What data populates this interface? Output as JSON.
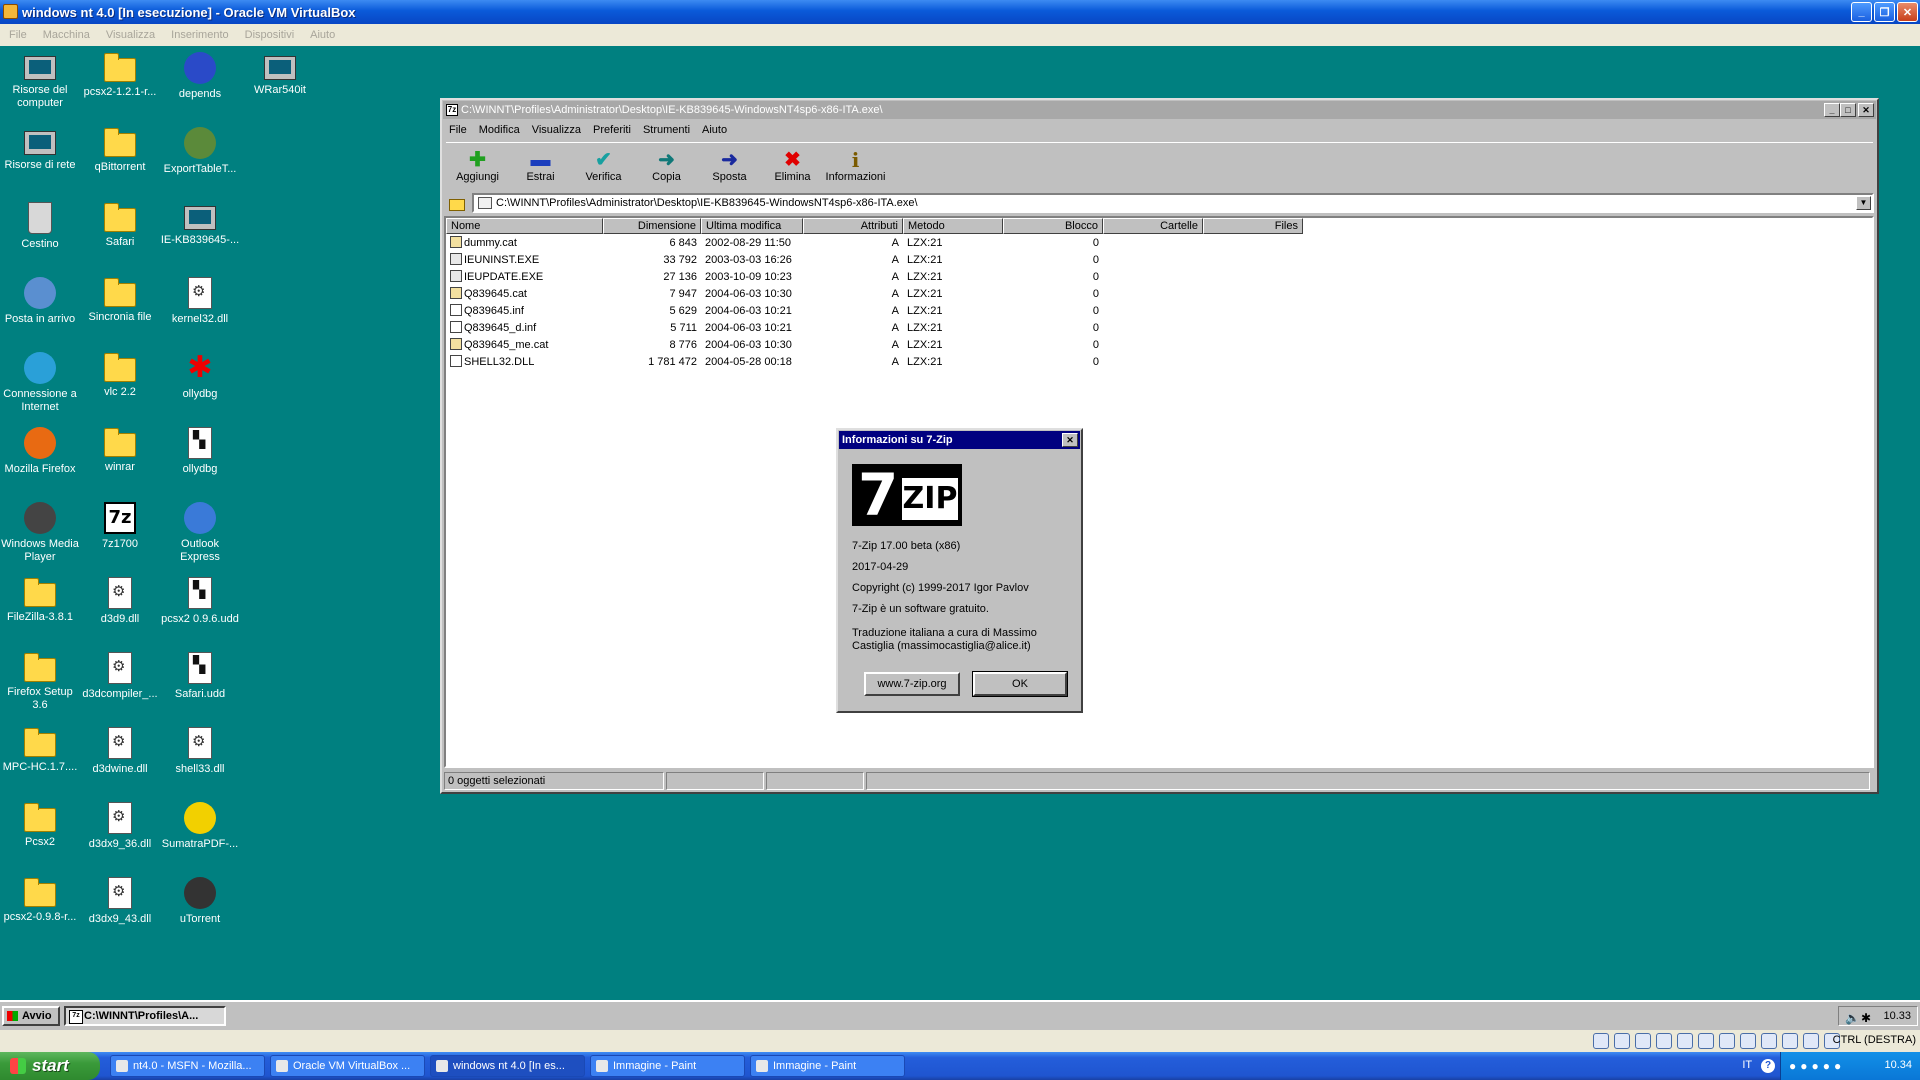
{
  "host": {
    "title": "windows nt 4.0 [In esecuzione] - Oracle VM VirtualBox",
    "menu": [
      "File",
      "Macchina",
      "Visualizza",
      "Inserimento",
      "Dispositivi",
      "Aiuto"
    ],
    "min_glyph": "_",
    "max_glyph": "❐",
    "close_glyph": "✕"
  },
  "desktop": {
    "icons": [
      {
        "label": "Risorse del computer",
        "icon": "computer-icon"
      },
      {
        "label": "pcsx2-1.2.1-r...",
        "icon": "folder-icon"
      },
      {
        "label": "depends",
        "icon": "depends-icon"
      },
      {
        "label": "WRar540it",
        "icon": "winrar-installer-icon"
      },
      {
        "label": "Risorse di rete",
        "icon": "network-icon"
      },
      {
        "label": "qBittorrent",
        "icon": "folder-icon"
      },
      {
        "label": "ExportTableT...",
        "icon": "app-icon"
      },
      {
        "label": "Cestino",
        "icon": "recycle-bin-icon"
      },
      {
        "label": "Safari",
        "icon": "folder-icon"
      },
      {
        "label": "IE-KB839645-...",
        "icon": "installer-icon"
      },
      {
        "label": "Posta in arrivo",
        "icon": "inbox-icon"
      },
      {
        "label": "Sincronia file",
        "icon": "briefcase-icon"
      },
      {
        "label": "kernel32.dll",
        "icon": "dll-file-icon"
      },
      {
        "label": "Connessione a Internet",
        "icon": "internet-connection-icon"
      },
      {
        "label": "vlc 2.2",
        "icon": "folder-icon"
      },
      {
        "label": "ollydbg",
        "icon": "ollydbg-icon"
      },
      {
        "label": "Mozilla Firefox",
        "icon": "firefox-icon"
      },
      {
        "label": "winrar",
        "icon": "folder-icon"
      },
      {
        "label": "ollydbg",
        "icon": "text-file-icon"
      },
      {
        "label": "Windows Media Player",
        "icon": "media-player-icon"
      },
      {
        "label": "7z1700",
        "icon": "7zip-icon"
      },
      {
        "label": "Outlook Express",
        "icon": "outlook-express-icon"
      },
      {
        "label": "FileZilla-3.8.1",
        "icon": "folder-icon"
      },
      {
        "label": "d3d9.dll",
        "icon": "dll-file-icon"
      },
      {
        "label": "pcsx2 0.9.6.udd",
        "icon": "udd-file-icon"
      },
      {
        "label": "Firefox Setup 3.6",
        "icon": "folder-icon"
      },
      {
        "label": "d3dcompiler_...",
        "icon": "dll-file-icon"
      },
      {
        "label": "Safari.udd",
        "icon": "udd-file-icon"
      },
      {
        "label": "MPC-HC.1.7....",
        "icon": "folder-icon"
      },
      {
        "label": "d3dwine.dll",
        "icon": "dll-file-icon"
      },
      {
        "label": "shell33.dll",
        "icon": "dll-file-icon"
      },
      {
        "label": "Pcsx2",
        "icon": "folder-icon"
      },
      {
        "label": "d3dx9_36.dll",
        "icon": "dll-file-icon"
      },
      {
        "label": "SumatraPDF-...",
        "icon": "pdf-icon"
      },
      {
        "label": "pcsx2-0.9.8-r...",
        "icon": "folder-icon"
      },
      {
        "label": "d3dx9_43.dll",
        "icon": "dll-file-icon"
      },
      {
        "label": "uTorrent",
        "icon": "utorrent-icon"
      }
    ]
  },
  "zip": {
    "title": "C:\\WINNT\\Profiles\\Administrator\\Desktop\\IE-KB839645-WindowsNT4sp6-x86-ITA.exe\\",
    "app_icon_text": "7z",
    "menu": [
      "File",
      "Modifica",
      "Visualizza",
      "Preferiti",
      "Strumenti",
      "Aiuto"
    ],
    "toolbar": [
      {
        "label": "Aggiungi",
        "glyph": "✚",
        "cls": "add",
        "icon": "add-icon"
      },
      {
        "label": "Estrai",
        "glyph": "▬",
        "cls": "ext",
        "icon": "extract-icon"
      },
      {
        "label": "Verifica",
        "glyph": "✔",
        "cls": "ver",
        "icon": "test-icon"
      },
      {
        "label": "Copia",
        "glyph": "➜",
        "cls": "cpy",
        "icon": "copy-icon"
      },
      {
        "label": "Sposta",
        "glyph": "➜",
        "cls": "mov",
        "icon": "move-icon"
      },
      {
        "label": "Elimina",
        "glyph": "✖",
        "cls": "del",
        "icon": "delete-icon"
      },
      {
        "label": "Informazioni",
        "glyph": "i",
        "cls": "inf",
        "icon": "info-icon"
      }
    ],
    "address": "C:\\WINNT\\Profiles\\Administrator\\Desktop\\IE-KB839645-WindowsNT4sp6-x86-ITA.exe\\",
    "dropdown_glyph": "▼",
    "columns": [
      "Nome",
      "Dimensione",
      "Ultima modifica",
      "Attributi",
      "Metodo",
      "Blocco",
      "Cartelle",
      "Files"
    ],
    "files": [
      {
        "name": "dummy.cat",
        "size": "6 843",
        "modified": "2002-08-29 11:50",
        "attr": "A",
        "method": "LZX:21",
        "block": "0",
        "type": "cat"
      },
      {
        "name": "IEUNINST.EXE",
        "size": "33 792",
        "modified": "2003-03-03 16:26",
        "attr": "A",
        "method": "LZX:21",
        "block": "0",
        "type": "exe"
      },
      {
        "name": "IEUPDATE.EXE",
        "size": "27 136",
        "modified": "2003-10-09 10:23",
        "attr": "A",
        "method": "LZX:21",
        "block": "0",
        "type": "exe"
      },
      {
        "name": "Q839645.cat",
        "size": "7 947",
        "modified": "2004-06-03 10:30",
        "attr": "A",
        "method": "LZX:21",
        "block": "0",
        "type": "cat"
      },
      {
        "name": "Q839645.inf",
        "size": "5 629",
        "modified": "2004-06-03 10:21",
        "attr": "A",
        "method": "LZX:21",
        "block": "0",
        "type": "inf"
      },
      {
        "name": "Q839645_d.inf",
        "size": "5 711",
        "modified": "2004-06-03 10:21",
        "attr": "A",
        "method": "LZX:21",
        "block": "0",
        "type": "inf"
      },
      {
        "name": "Q839645_me.cat",
        "size": "8 776",
        "modified": "2004-06-03 10:30",
        "attr": "A",
        "method": "LZX:21",
        "block": "0",
        "type": "cat"
      },
      {
        "name": "SHELL32.DLL",
        "size": "1 781 472",
        "modified": "2004-05-28 00:18",
        "attr": "A",
        "method": "LZX:21",
        "block": "0",
        "type": "dll"
      }
    ],
    "status": "0 oggetti selezionati"
  },
  "about": {
    "title": "Informazioni su 7-Zip",
    "logo_seven": "7",
    "logo_zip": "ZIP",
    "version": "7-Zip 17.00 beta (x86)",
    "date": "2017-04-29",
    "copyright": "Copyright (c) 1999-2017 Igor Pavlov",
    "free": "7-Zip è un software gratuito.",
    "translation_line1": "Traduzione italiana a cura di Massimo",
    "translation_line2": "Castiglia (massimocastiglia@alice.it)",
    "website_button": "www.7-zip.org",
    "ok_button": "OK"
  },
  "guest_taskbar": {
    "start": "Avvio",
    "task": "C:\\WINNT\\Profiles\\A...",
    "clock": "10.33"
  },
  "vbox_status": {
    "host_key": "CTRL (DESTRA)"
  },
  "xp_taskbar": {
    "start": "start",
    "tasks": [
      "nt4.0 - MSFN - Mozilla...",
      "Oracle VM VirtualBox ...",
      "windows nt 4.0 [In es...",
      "Immagine - Paint",
      "Immagine - Paint"
    ],
    "lang": "IT",
    "help": "?",
    "clock": "10.34"
  }
}
